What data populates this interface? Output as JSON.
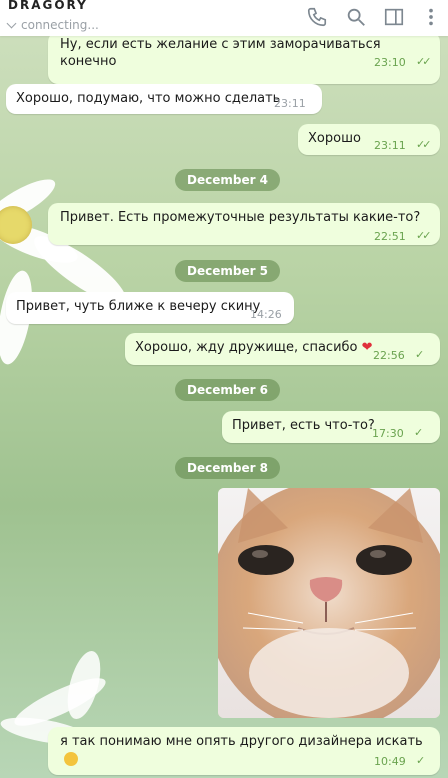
{
  "header": {
    "title": "DRAGORY",
    "status": "connecting..."
  },
  "messages": [
    {
      "text": "Ну, если есть желание с этим заморачиваться конечно",
      "time": "23:10"
    },
    {
      "text": "Хорошо, подумаю, что можно сделать",
      "time": "23:11"
    },
    {
      "text": "Хорошо",
      "time": "23:11"
    },
    {
      "text": "Привет. Есть промежуточные результаты какие-то?",
      "time": "22:51"
    },
    {
      "text": "Привет, чуть ближе к вечеру скину",
      "time": "14:26"
    },
    {
      "text": "Хорошо, жду дружище, спасибо",
      "time": "22:56"
    },
    {
      "text": "Привет, есть что-то?",
      "time": "17:30"
    },
    {
      "text": "я так понимаю мне опять другого дизайнера искать",
      "time": "10:49"
    }
  ],
  "dates": {
    "d1": "December 4",
    "d2": "December 5",
    "d3": "December 6",
    "d4": "December 8"
  },
  "icons": {
    "phone": "phone-icon",
    "search": "search-icon",
    "sidebar": "sidebar-toggle-icon",
    "more": "more-vertical-icon"
  }
}
